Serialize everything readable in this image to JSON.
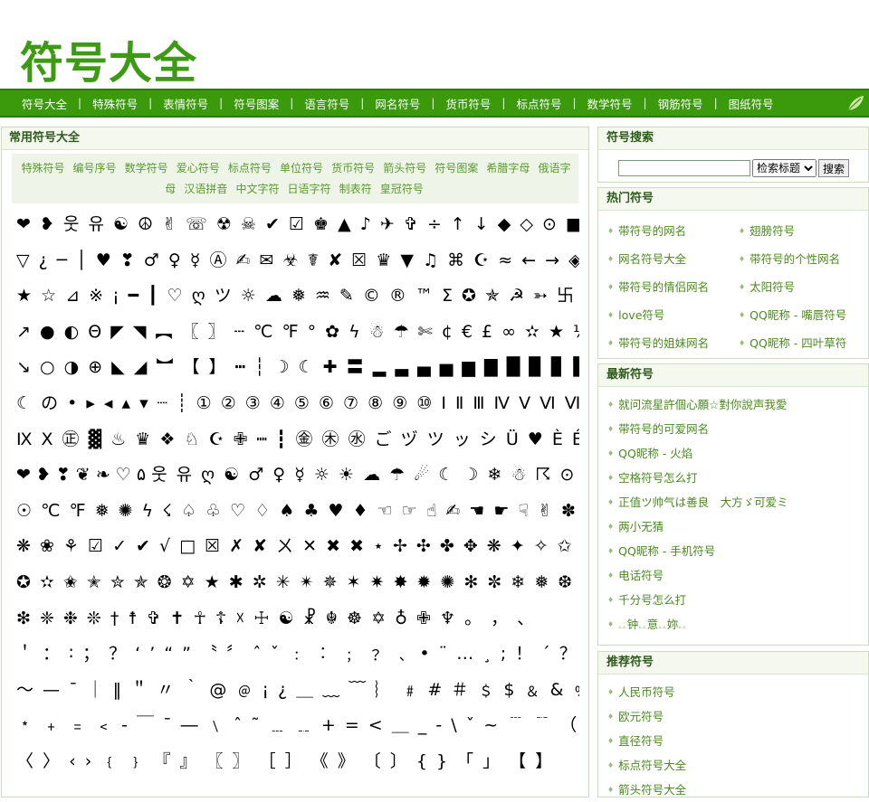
{
  "logo": "符号大全",
  "nav": [
    "符号大全",
    "特殊符号",
    "表情符号",
    "符号图案",
    "语言符号",
    "网名符号",
    "货币符号",
    "标点符号",
    "数学符号",
    "钢筋符号",
    "图纸符号"
  ],
  "main": {
    "title": "常用符号大全",
    "categories": [
      "特殊符号",
      "编号序号",
      "数学符号",
      "爱心符号",
      "标点符号",
      "单位符号",
      "货币符号",
      "箭头符号",
      "符号图案",
      "希腊字母",
      "俄语字母",
      "汉语拼音",
      "中文字符",
      "日语字符",
      "制表符",
      "皇冠符号"
    ],
    "symbol_lines": [
      "❤ ❥ 웃 유 ☯ ☮ ✌ ☏ ☢ ☠ ✔ ☑ ♚ ▲ ♪ ✈ ✞ ÷ ↑ ↓ ◆ ◇ ⊙ ■ □ △",
      "▽ ¿ ─ │ ♥ ❣ ♂ ♀ ☿ Ⓐ ✍ ✉ ☣ ☤ ✘ ☒ ♛ ▼ ♫ ⌘ ☪ ≈ ← → ◈ ◎ ☉",
      "★ ☆ ⊿ ※ ¡ ━ ┃ ♡ ღ ツ ☼ ☁ ❅ ♒ ✎ © ® ™ Σ ✪ ✯ ☭ ➳ 卐 √ ↖",
      "↗ ● ◐ Θ ◤ ◥ ︻ 〖 〗 ┄ ℃ ℉ ° ✿ ϟ ☃ ☂ ✄ ¢ € £ ∞ ✫ ★ ½ ✡ × ↙",
      "↘ ○ ◑ ⊕ ◣ ◢ ︼ 【 】 ┅ ┆ ☽ ☾ ✚ 〓 ▂ ▃ ▄ ▅ ▆ ▇ █ ▉ ▊ ▋ ▌ ▍ ▎ ▏ ↔ ↕ ☽",
      "☾ の • ▸ ◂ ▴ ▾ ┈ ┊ ① ② ③ ④ ⑤ ⑥ ⑦ ⑧ ⑨ ⑩ Ⅰ Ⅱ Ⅲ Ⅳ Ⅴ Ⅵ Ⅶ Ⅷ",
      "Ⅸ Ⅹ ㊣ ▓ ♨ ♛ ❖ ♘ ☪ ✙ ┉ ┇ ㊎ ㊍ ㊌ ご ヅ ツ ッ シ Ü ♥ È É □ □ ™ ڪ",
      "❤ ❥ ❣ ❦ ❧ ♡ ۵ 웃 유 ღ ☯ ♂ ♀ ☿ ☼ ☀ ☁ ☂ ☄ ☾ ☽ ❄ ☃ ☈ ⊙",
      "☉ ℃ ℉ ❅ ✺ ϟ ☇ ♤ ♧ ♡ ♢ ♠ ♣ ♥ ♦ ☜ ☞ ☝ ✍ ☚ ☛ ☟ ✌ ✽ ✾ ✿ ❁ ❃",
      "❋ ❀ ⚘ ☑ ✓ ✔ √ □ ☒ ✗ ✘ ㄨ ✕ ✖ ✖ ⋆ ✢ ✣ ✤ ✥ ❋ ✦ ✧ ✩ ✰",
      "✪ ✫ ✬ ✭ ✮ ✯ ❂ ✡ ★ ✱ ✲ ✳ ✴ ✵ ✶ ✷ ✸ ✹ ✺ ✻ ✼ ❄ ❅ ❆",
      "❇ ❈ ❉ ❊ † ☨ ✞ ✝ ☥ ☦ ☓ ☩ ☯ ☧ ☬ ☸ ✡ ♁ ✙ ♆ 。 ， 、",
      "＇ ： ∶ ； ？ ‘ ’ “ ” 〝 〞 ˆ ˇ ﹕ ︰ ﹔ ﹖ ﹑ • ¨ … ¸ ; ！ ´ ？ ！",
      "～ — ˉ ｜ ‖ ＂ 〃 ｀ @ ﹫ ¡ ¿ ＿ ﹏ ﹋ ︴ ﹟ # ＃ ﹩ $ ﹠ & ﹪ % *",
      "﹡ ﹢ ﹦ ﹤ ‐ ￣ ¯ ― ﹨ ˆ ˜ ﹍ ﹎ + = < ＿ _ - \\ ˇ ~ ﹉ ﹊ （ ）",
      "〈 〉 ‹ › ﹛ ﹜ 『 』 〖 〗 ［ ］ 《 》 〔 〕 { } 「 」 【 】"
    ]
  },
  "search": {
    "title": "符号搜索",
    "placeholder": "",
    "select_value": "检索标题",
    "button": "搜索"
  },
  "hot": {
    "title": "热门符号",
    "items": [
      "带符号的网名",
      "翅膀符号",
      "网名符号大全",
      "带符号的个性网名",
      "带符号的情侣网名",
      "太阳符号",
      "love符号",
      "QQ昵称 - 嘴唇符号",
      "带符号的姐妹网名",
      "QQ昵称 - 四叶草符"
    ]
  },
  "latest": {
    "title": "最新符号",
    "items": [
      "就问流星許個心願☆對你說声我愛",
      "带符号的可爱网名",
      "QQ昵称 - 火焰",
      "空格符号怎么打",
      "正值ツ帅气は善良　大方ゞ可爱ミ",
      "两小无猜",
      "QQ昵称 - 手机符号",
      "电话符号",
      "千分号怎么打",
      "ۦۦ钟ۦۦ意ۦۦ妳ۦۦ"
    ]
  },
  "recommend": {
    "title": "推荐符号",
    "items": [
      "人民币符号",
      "欧元符号",
      "直径符号",
      "标点符号大全",
      "箭头符号大全"
    ]
  }
}
